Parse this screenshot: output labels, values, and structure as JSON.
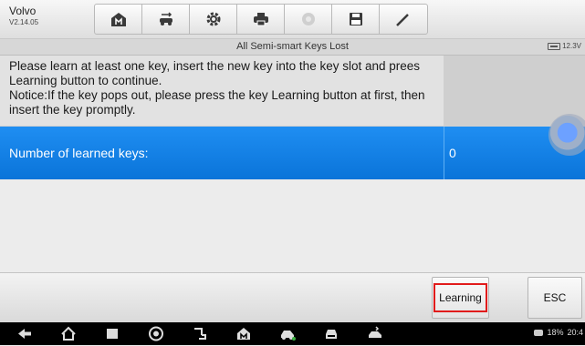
{
  "app": {
    "name": "Volvo",
    "version": "V2.14.05"
  },
  "toolbar": {
    "tools": [
      {
        "icon": "home-icon"
      },
      {
        "icon": "vehicle-swap-icon"
      },
      {
        "icon": "gear-icon"
      },
      {
        "icon": "printer-icon"
      },
      {
        "icon": "help-icon"
      },
      {
        "icon": "save-icon"
      },
      {
        "icon": "pen-icon"
      }
    ]
  },
  "titlebar": {
    "title": "All Semi-smart Keys Lost",
    "voltage": "12.3V"
  },
  "message": {
    "text": "Please learn at least one key, insert the new key into the key slot and prees Learning button to continue.\nNotice:If the key pops out, please press the key Learning button at first, then insert the key promptly."
  },
  "selected_row": {
    "label": "Number of learned keys:",
    "value": "0"
  },
  "buttons": {
    "learning": "Learning",
    "esc": "ESC"
  },
  "navbar": {
    "icons": [
      "back-icon",
      "home-icon",
      "recent-apps-icon",
      "browser-icon",
      "link-icon",
      "app-home-icon",
      "car-icon",
      "car-front-icon",
      "car-tools-icon"
    ],
    "status": {
      "battery": "18%",
      "time": "20:4"
    }
  },
  "colors": {
    "selection": "#0a74d9",
    "highlight_border": "#e11b1b"
  }
}
